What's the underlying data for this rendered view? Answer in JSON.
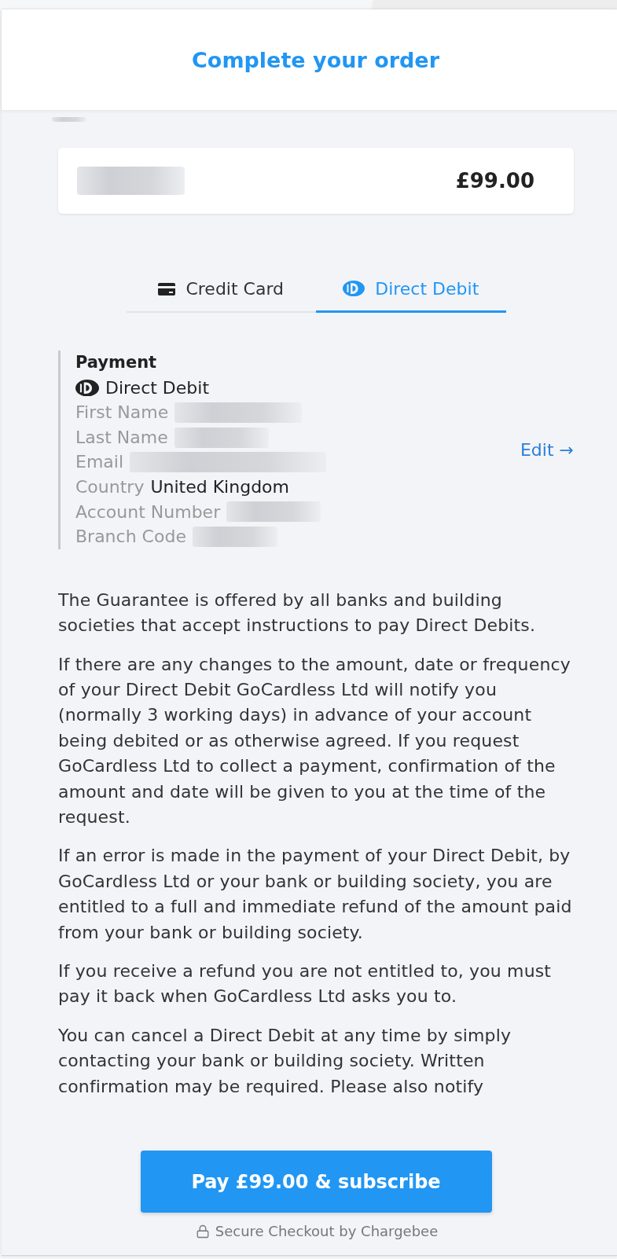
{
  "page": {
    "title": "Complete your order"
  },
  "caption": {
    "redacted": true
  },
  "order_item": {
    "redacted": true,
    "price": "£99.00"
  },
  "tabs": [
    {
      "label": "Credit Card",
      "kind": "card",
      "selected": false
    },
    {
      "label": "Direct Debit",
      "kind": "direct_debit",
      "selected": true
    }
  ],
  "payment": {
    "title": "Payment",
    "method": {
      "label": "Direct Debit",
      "kind": "direct_debit"
    },
    "fields": [
      {
        "label": "First Name",
        "redacted": true
      },
      {
        "label": "Last Name",
        "redacted": true
      },
      {
        "label": "Email",
        "redacted": true
      },
      {
        "label": "Country",
        "redacted": false,
        "value": "United Kingdom"
      },
      {
        "label": "Account Number",
        "redacted": true
      },
      {
        "label": "Branch Code",
        "redacted": true
      }
    ],
    "edit": "Edit →"
  },
  "mandate_paragraphs": [
    "The Guarantee is offered by all banks and building societies that accept instructions to pay Direct Debits.",
    "If there are any changes to the amount, date or frequency of your Direct Debit GoCardless Ltd will notify you (normally 3 working days) in advance of your account being debited or as otherwise agreed. If you request GoCardless Ltd to collect a payment, confirmation of the amount and date will be given to you at the time of the request.",
    "If an error is made in the payment of your Direct Debit, by GoCardless Ltd or your bank or building society, you are entitled to a full and immediate refund of the amount paid from your bank or building society.",
    "If you receive a refund you are not entitled to, you must pay it back when GoCardless Ltd asks you to.",
    "You can cancel a Direct Debit at any time by simply contacting your bank or building society. Written confirmation may be required. Please also notify"
  ],
  "pay_button": "Pay £99.00 & subscribe",
  "footer": "Secure Checkout by Chargebee"
}
